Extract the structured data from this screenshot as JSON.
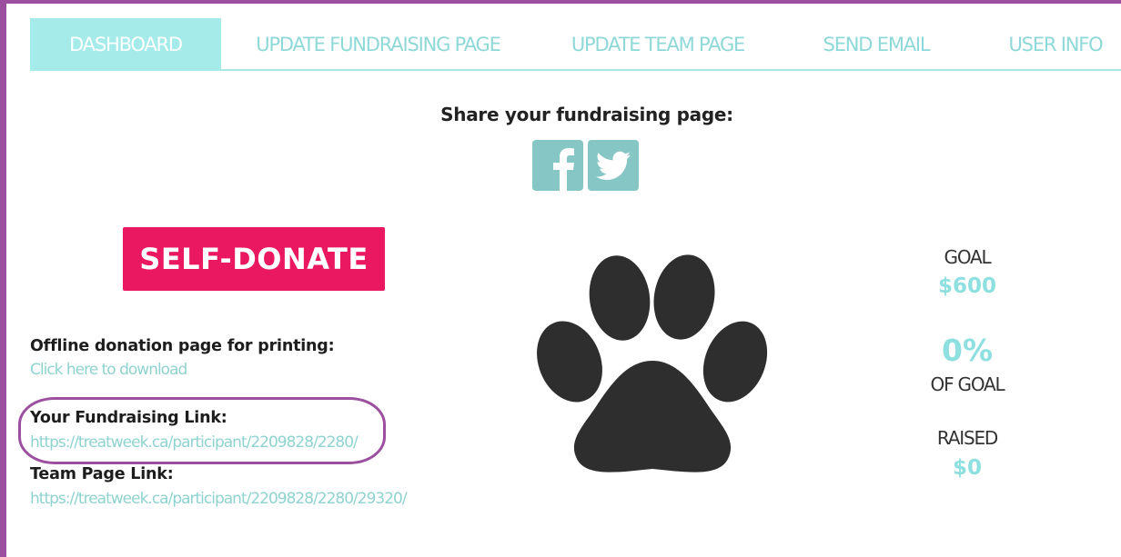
{
  "nav": {
    "tabs": [
      {
        "label": "DASHBOARD",
        "active": true
      },
      {
        "label": "UPDATE FUNDRAISING PAGE",
        "active": false
      },
      {
        "label": "UPDATE TEAM PAGE",
        "active": false
      },
      {
        "label": "SEND EMAIL",
        "active": false
      },
      {
        "label": "USER INFO",
        "active": false
      }
    ]
  },
  "share": {
    "title": "Share your fundraising page:",
    "icons": [
      "facebook-icon",
      "twitter-icon"
    ]
  },
  "self_donate_label": "SELF-DONATE",
  "offline": {
    "label": "Offline donation page for printing:",
    "link": "Click here to download"
  },
  "fundraising": {
    "label": "Your Fundraising Link:",
    "link": "https://treatweek.ca/participant/2209828/2280/"
  },
  "team": {
    "label": "Team Page Link:",
    "link": "https://treatweek.ca/participant/2209828/2280/29320/"
  },
  "stats": {
    "goal_label": "GOAL",
    "goal_value": "$600",
    "percent_value": "0%",
    "percent_label": "OF GOAL",
    "raised_label": "RAISED",
    "raised_value": "$0"
  },
  "colors": {
    "accent": "#a4ebe9",
    "link": "#8fd3d0",
    "donate": "#ea1860",
    "frame": "#9c4f9f",
    "paw": "#2e2e2e"
  }
}
